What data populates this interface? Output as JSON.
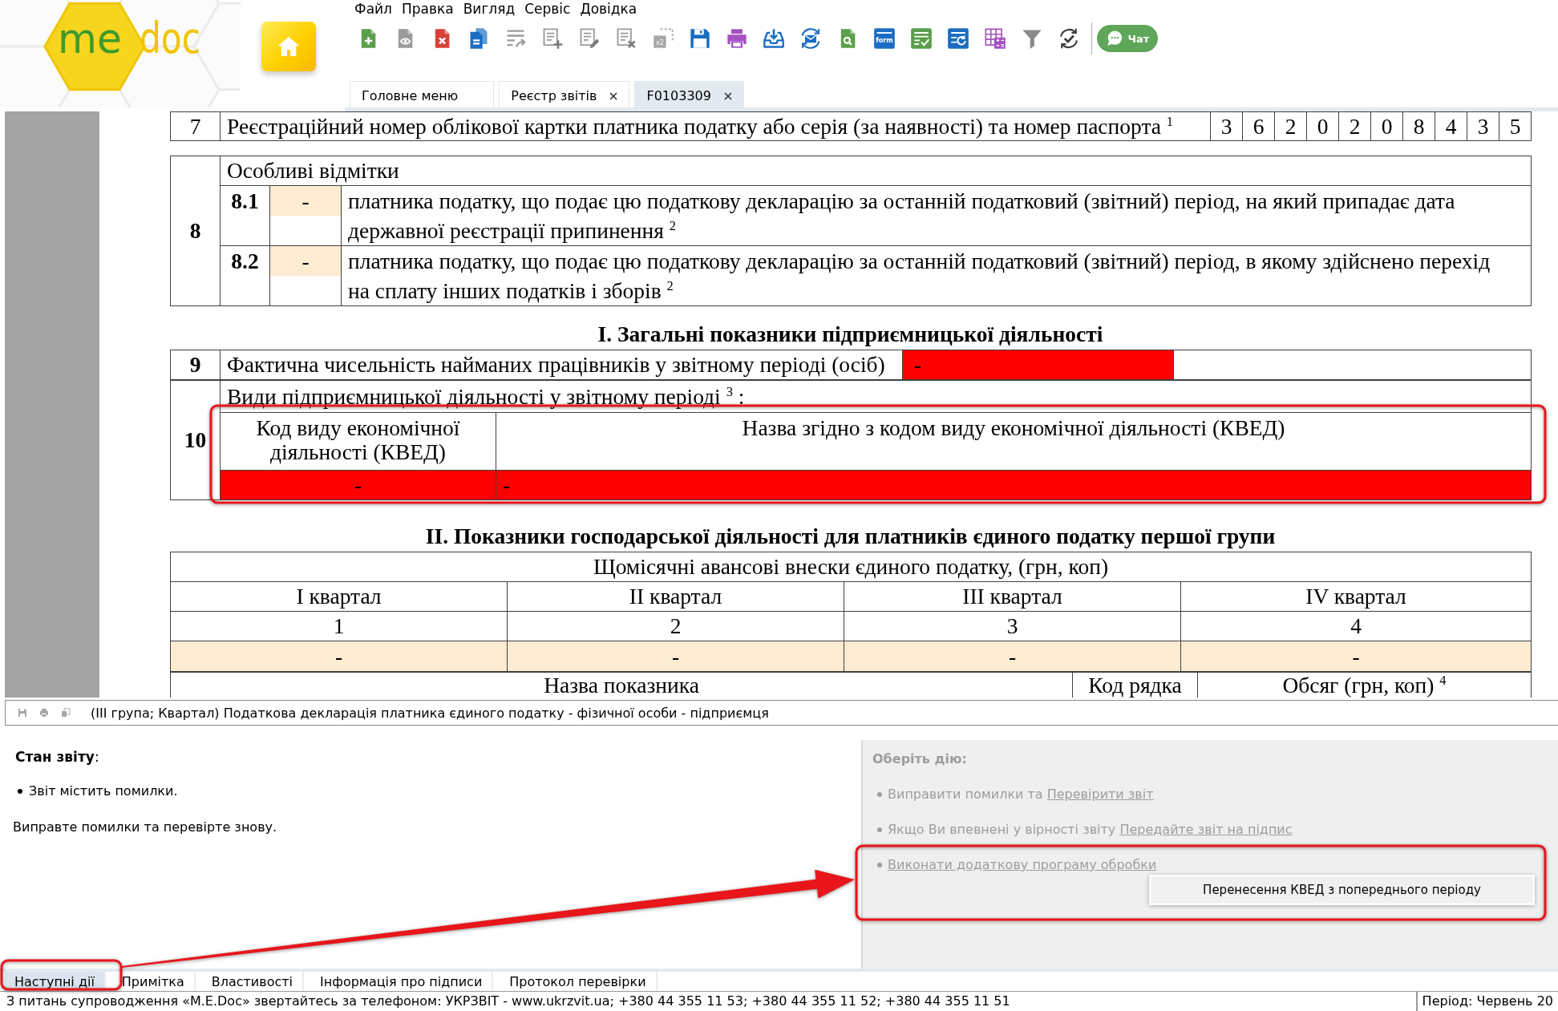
{
  "logo": {
    "text": [
      "me",
      "doc"
    ]
  },
  "menu": [
    "Файл",
    "Правка",
    "Вигляд",
    "Сервіс",
    "Довідка"
  ],
  "toolbar": {
    "copies_icon_label": "x2",
    "form_icon_label": "form",
    "chat_button": "Чат"
  },
  "tabs": [
    {
      "label": "Головне меню",
      "selected": false,
      "closable": false
    },
    {
      "label": "Реєстр звітів",
      "selected": false,
      "closable": true
    },
    {
      "label": "F0103309",
      "selected": true,
      "closable": true
    }
  ],
  "document": {
    "row_7": {
      "number": "7",
      "label": "Реєстраційний номер облікової картки платника податку або серія (за наявності) та номер паспорта $^{1}$",
      "digits": [
        "3",
        "6",
        "2",
        "0",
        "2",
        "0",
        "8",
        "4",
        "3",
        "5"
      ]
    },
    "row_8": {
      "number": "8",
      "title": "Особливі відмітки",
      "items": [
        {
          "code": "8.1",
          "value": "-",
          "error": false,
          "text": "платника податку, що подає цю податкову декларацію за останній податковий (звітний) період, на який припадає дата державної реєстрації припинення $^{2}$"
        },
        {
          "code": "8.2",
          "value": "-",
          "error": false,
          "text": "платника податку, що подає цю податкову декларацію за останній податковий (звітний) період, в якому здійснено перехід на сплату інших податків і зборів $^{2}$"
        }
      ]
    },
    "section_1": "I. Загальні показники підприємницької діяльності",
    "row_9": {
      "number": "9",
      "label": "Фактична чисельність найманих працівників у звітному періоді (осіб)",
      "value": "-",
      "error": true
    },
    "row_10": {
      "number": "10",
      "label": "Види підприємницької діяльності у звітному періоді $^{3}$ :",
      "columns": [
        "Код виду економічної діяльності (КВЕД)",
        "Назва згідно з кодом виду економічної діяльності (КВЕД)"
      ],
      "rows": [
        {
          "cells": [
            "-",
            "-"
          ],
          "error": true
        }
      ]
    },
    "section_2": "II. Показники господарської діяльності для платників єдиного податку першої групи",
    "advance_table": {
      "title": "Щомісячні авансові внески єдиного податку, (грн, коп)",
      "columns": [
        "I квартал",
        "II квартал",
        "III квартал",
        "IV квартал"
      ],
      "numbers": [
        "1",
        "2",
        "3",
        "4"
      ],
      "values": [
        {
          "value": "-",
          "error": false
        },
        {
          "value": "-",
          "error": false
        },
        {
          "value": "-",
          "error": false
        },
        {
          "value": "-",
          "error": false
        }
      ]
    },
    "indicator_table": {
      "columns": [
        "Назва показника",
        "Код рядка",
        "Обсяг (грн, коп) $^{4}$"
      ]
    }
  },
  "document_status": "(III група; Квартал) Податкова декларація платника єдиного податку - фізичної особи - підприємця",
  "report_state": {
    "title": "**Стан звіту**:",
    "items": [
      "Звіт містить помилки."
    ],
    "hint": "Виправте помилки та перевірте знову."
  },
  "actions": {
    "title": "Оберіть дію:",
    "disabled": true,
    "items": [
      {
        "text": "Виправити помилки та",
        "link": "Перевірити звіт"
      },
      {
        "text": "Якщо Ви впевнені у вірності звіту",
        "link": "Передайте звіт на підпис"
      },
      {
        "link": "Виконати додаткову програму обробки"
      }
    ],
    "popup_menu": [
      "Перенесення КВЕД з попереднього періоду"
    ]
  },
  "bottom_tabs": [
    {
      "label": "Наступні дії",
      "selected": true
    },
    {
      "label": "Примітка",
      "selected": false
    },
    {
      "label": "Властивості",
      "selected": false
    },
    {
      "label": "Інформація про підписи",
      "selected": false
    },
    {
      "label": "Протокол перевірки",
      "selected": false
    }
  ],
  "status_bar": {
    "message": "З питань супроводження «M.E.Doc» звертайтесь за телефоном: УКРЗВІТ - www.ukrzvit.ua; +380 44 355 11 53; +380 44 355 11 52; +380 44 355 11 51",
    "period": "Період: Червень 20"
  }
}
